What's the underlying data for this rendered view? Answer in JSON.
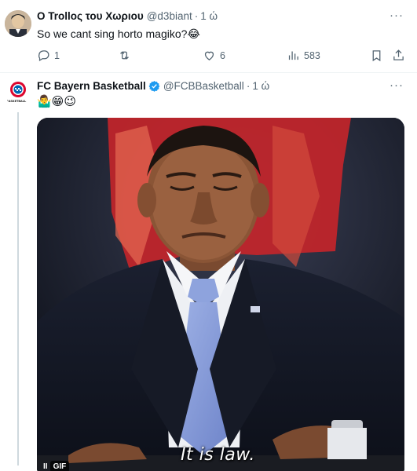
{
  "reply": {
    "display_name": "Ο Trollος του Χωριου",
    "handle": "@d3biant",
    "separator": "·",
    "time": "1 ώ",
    "more": "···",
    "text": "So we cant sing horto magiko?😂",
    "actions": {
      "replies": "1",
      "reposts": "",
      "likes": "6",
      "views": "583"
    }
  },
  "quoted": {
    "display_name": "FC Bayern Basketball",
    "handle": "@FCBBasketball",
    "separator": "·",
    "time": "1 ώ",
    "more": "···",
    "text": "🤷‍♂️😁😉",
    "avatar_caption": "BASKETBALL",
    "verified_color": "#1d9bf0",
    "media": {
      "caption": "It is law.",
      "badge": "GIF",
      "pause_symbol": "II"
    }
  },
  "colors": {
    "accent": "#1d9bf0",
    "secondary_text": "#536471",
    "divider": "#eff3f4"
  }
}
